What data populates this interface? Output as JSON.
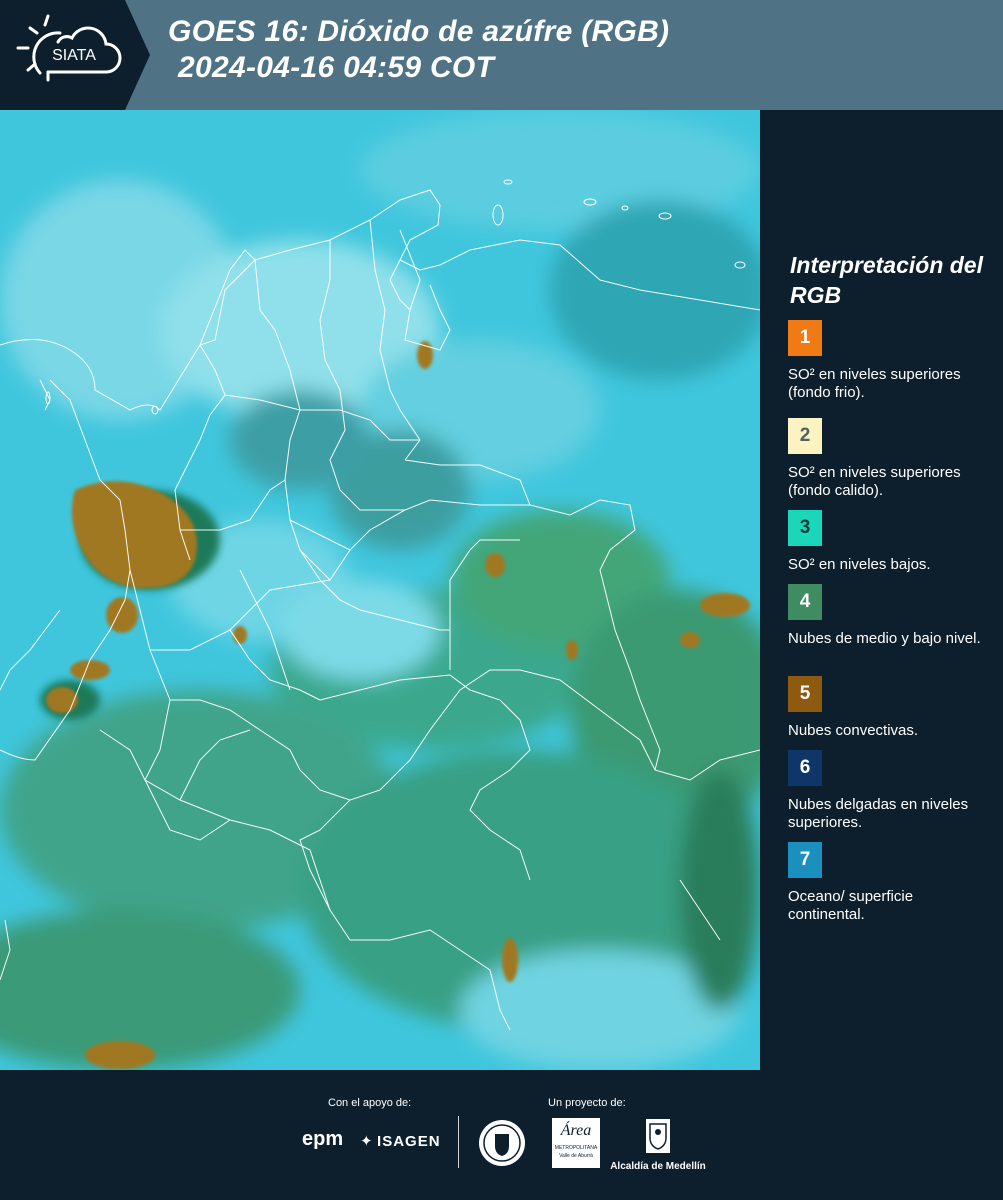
{
  "header": {
    "brand": "SIATA",
    "title_line1": "GOES 16: Dióxido de azúfre (RGB)",
    "title_line2": "2024-04-16 04:59 COT"
  },
  "legend": {
    "title": "Interpretación del RGB",
    "items": [
      {
        "number": "1",
        "color": "#f07a14",
        "number_color": "#ffffff",
        "text": "SO² en niveles superiores (fondo frio)."
      },
      {
        "number": "2",
        "color": "#fbf3c1",
        "number_color": "#556060",
        "text": "SO² en niveles superiores (fondo calido)."
      },
      {
        "number": "3",
        "color": "#19d7b8",
        "number_color": "#0d3d3d",
        "text": "SO² en niveles bajos."
      },
      {
        "number": "4",
        "color": "#3f8c63",
        "number_color": "#ffffff",
        "text": "Nubes de medio y bajo nivel."
      },
      {
        "number": "5",
        "color": "#8e5a10",
        "number_color": "#ffffff",
        "text": "Nubes convectivas."
      },
      {
        "number": "6",
        "color": "#0f3668",
        "number_color": "#ffffff",
        "text": "Nubes delgadas en niveles superiores."
      },
      {
        "number": "7",
        "color": "#1b8fbe",
        "number_color": "#ffffff",
        "text": "Oceano/ superficie continental."
      }
    ]
  },
  "footer": {
    "support_label": "Con el apoyo de:",
    "project_label": "Un proyecto de:",
    "epm": "epm",
    "isagen": "ISAGEN",
    "area": "Área",
    "area_sub": "METROPOLITANA",
    "area_sub2": "Valle de Aburrá",
    "alcaldia": "Alcaldía de Medellín"
  },
  "colors": {
    "header_bg": "#4f7384",
    "panel_bg": "#0d1f2d",
    "cloud_cyan": "#36c6e0",
    "land_green": "#3a9a72",
    "convective_brown": "#a57b26"
  }
}
